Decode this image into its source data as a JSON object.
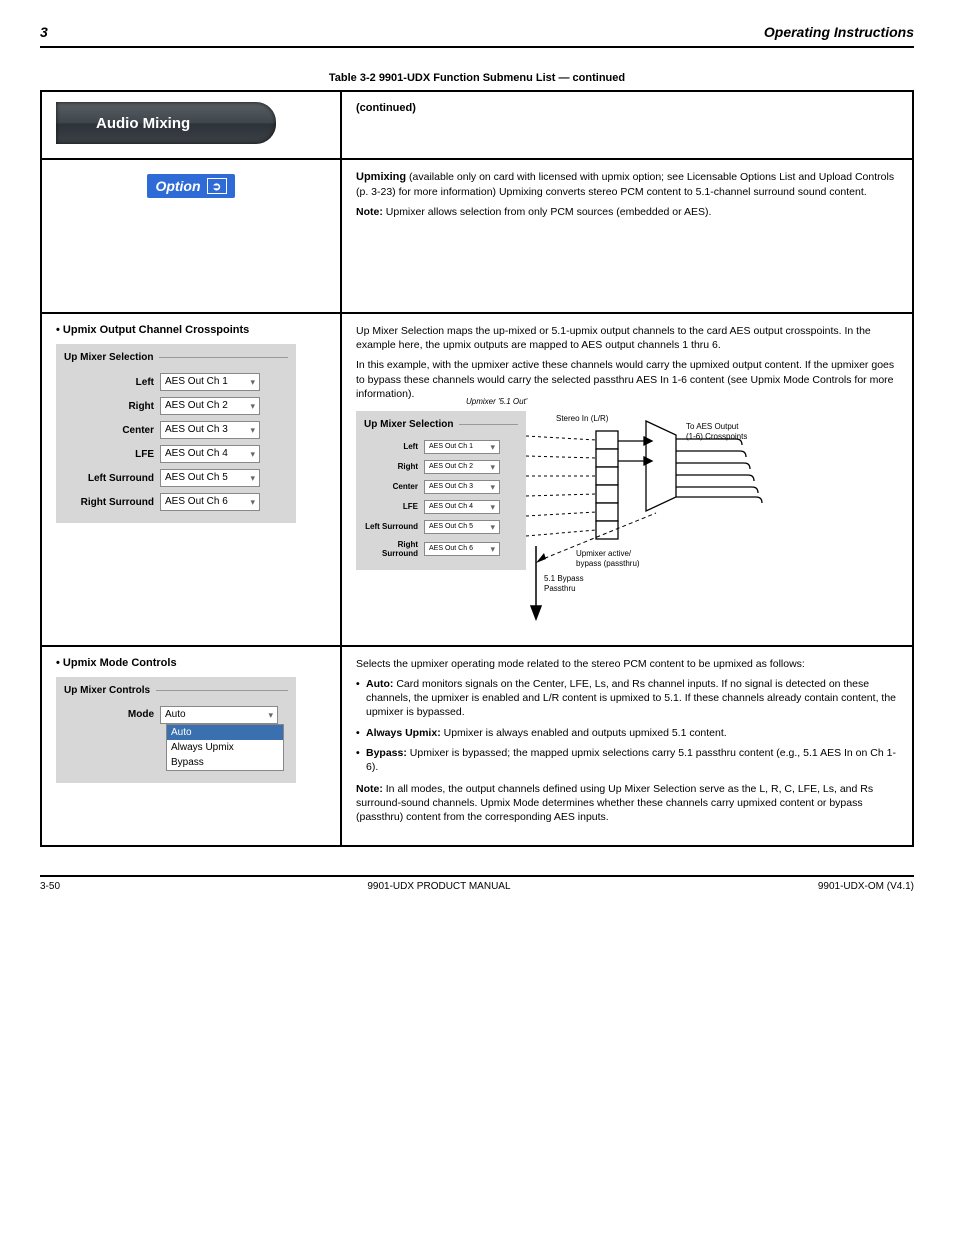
{
  "header": {
    "chapter_num": "3",
    "chapter_title": "Operating Instructions"
  },
  "table_caption": "Table 3-2  9901-UDX Function Submenu List — continued",
  "banner": {
    "label": "Audio Mixing"
  },
  "banner_desc": "(continued)",
  "option": {
    "badge": "Option",
    "arrow": "➲",
    "upmix_row": "Upmixing",
    "upmix_desc": "(available only on card with licensed with upmix option; see Licensable Options List and Upload Controls (p. 3-23) for more information) Upmixing converts stereo PCM content to 5.1-channel surround sound content.",
    "upmix_note_label": "Note:",
    "upmix_note": "Upmixer allows selection from only PCM sources (embedded or AES)."
  },
  "upmixer_selection": {
    "heading": "• Upmix Output Channel Crosspoints",
    "legend": "Up Mixer Selection",
    "rows": [
      {
        "label": "Left",
        "value": "AES Out Ch 1"
      },
      {
        "label": "Right",
        "value": "AES Out Ch 2"
      },
      {
        "label": "Center",
        "value": "AES Out Ch 3"
      },
      {
        "label": "LFE",
        "value": "AES Out Ch 4"
      },
      {
        "label": "Left Surround",
        "value": "AES Out Ch 5"
      },
      {
        "label": "Right Surround",
        "value": "AES Out Ch 6"
      }
    ],
    "desc_p1": "Up Mixer Selection maps the up-mixed or 5.1-upmix output channels to the card AES output crosspoints. In the example here, the upmix outputs are mapped to AES output channels 1 thru 6.",
    "desc_p2": "In this example, with the upmixer active these channels would carry the upmixed output content. If the upmixer goes to bypass these channels would carry the selected passthru AES In 1-6 content (see Upmix Mode Controls for more information).",
    "diag_label": "Upmixer '5.1 Out'",
    "stereo_in": "Stereo In (L/R)",
    "bypass_passthru": "5.1 Bypass Passthru",
    "bypass_upmixer": "Upmixer active/bypass (passthru)",
    "to_aes": "To AES Output (1-6) Crosspoints",
    "mini": {
      "legend": "Up Mixer Selection",
      "rows": [
        {
          "label": "Left",
          "value": "AES Out Ch 1"
        },
        {
          "label": "Right",
          "value": "AES Out Ch 2"
        },
        {
          "label": "Center",
          "value": "AES Out Ch 3"
        },
        {
          "label": "LFE",
          "value": "AES Out Ch 4"
        },
        {
          "label": "Left Surround",
          "value": "AES Out Ch 5"
        },
        {
          "label": "Right Surround",
          "value": "AES Out Ch 6"
        }
      ]
    }
  },
  "upmix_mode": {
    "heading": "• Upmix Mode Controls",
    "legend": "Up Mixer Controls",
    "mode_label": "Mode",
    "mode_value": "Auto",
    "options": [
      "Auto",
      "Always Upmix",
      "Bypass"
    ],
    "desc_intro": "Selects the upmixer operating mode related to the stereo PCM content to be upmixed as follows:",
    "bullets": [
      {
        "b": "Auto:",
        "t": " Card monitors signals on the Center, LFE, Ls, and Rs channel inputs. If no signal is detected on these channels, the upmixer is enabled and L/R content is upmixed to 5.1. If these channels already contain content, the upmixer is bypassed."
      },
      {
        "b": "Always Upmix:",
        "t": " Upmixer is always enabled and outputs upmixed 5.1 content."
      },
      {
        "b": "Bypass:",
        "t": " Upmixer is bypassed; the mapped upmix selections carry 5.1 passthru content (e.g., 5.1 AES In on Ch 1-6)."
      }
    ],
    "note_label": "Note:",
    "note": "In all modes, the output channels defined using Up Mixer Selection serve as the L, R, C, LFE, Ls, and Rs surround-sound channels. Upmix Mode determines whether these channels carry upmixed content or bypass (passthru) content from the corresponding AES inputs."
  },
  "footer": {
    "left": "3-50",
    "center": "9901-UDX PRODUCT MANUAL",
    "right": "9901-UDX-OM (V4.1)"
  }
}
